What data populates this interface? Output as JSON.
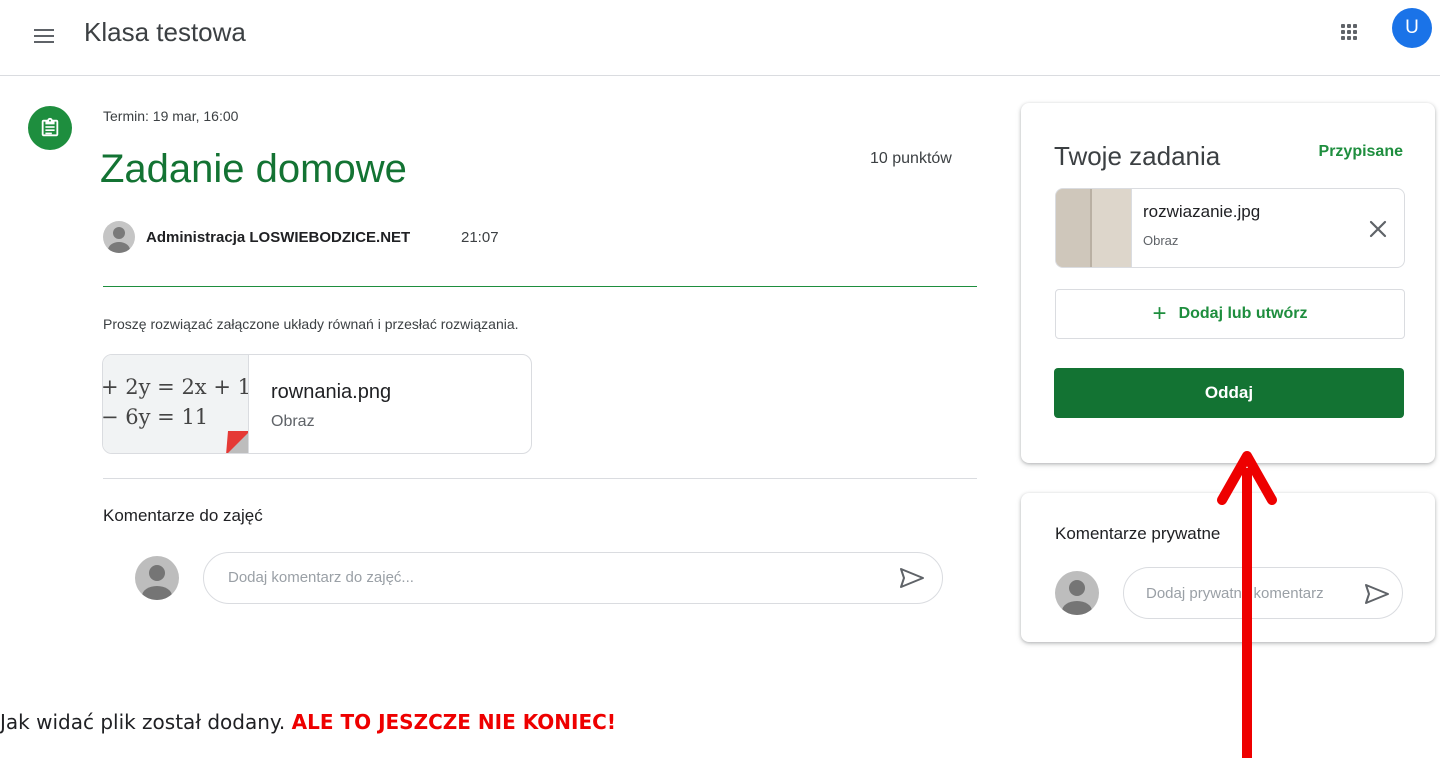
{
  "header": {
    "class_title": "Klasa testowa",
    "avatar_letter": "U"
  },
  "assignment": {
    "due": "Termin: 19 mar, 16:00",
    "title": "Zadanie domowe",
    "points": "10 punktów",
    "author": "Administracja LOSWIEBODZICE.NET",
    "time": "21:07",
    "instructions": "Proszę rozwiązać załączone układy równań i przesłać rozwiązania.",
    "attachment": {
      "name": "rownania.png",
      "type": "Obraz",
      "thumb_line1": "+ 2y = 2x + 1",
      "thumb_line2": "− 6y = 11"
    }
  },
  "class_comments": {
    "heading": "Komentarze do zajęć",
    "placeholder": "Dodaj komentarz do zajęć..."
  },
  "your_work": {
    "title": "Twoje zadania",
    "status": "Przypisane",
    "file": {
      "name": "rozwiazanie.jpg",
      "type": "Obraz"
    },
    "add_label": "Dodaj lub utwórz",
    "submit_label": "Oddaj"
  },
  "private_comments": {
    "heading": "Komentarze prywatne",
    "placeholder": "Dodaj prywatny komentarz"
  },
  "caption": {
    "text": "Jak widać plik został dodany.",
    "warning": "ALE TO JESZCZE NIE KONIEC!"
  },
  "colors": {
    "green": "#137333",
    "accent_blue": "#1a73e8",
    "arrow_red": "#ee0000"
  }
}
